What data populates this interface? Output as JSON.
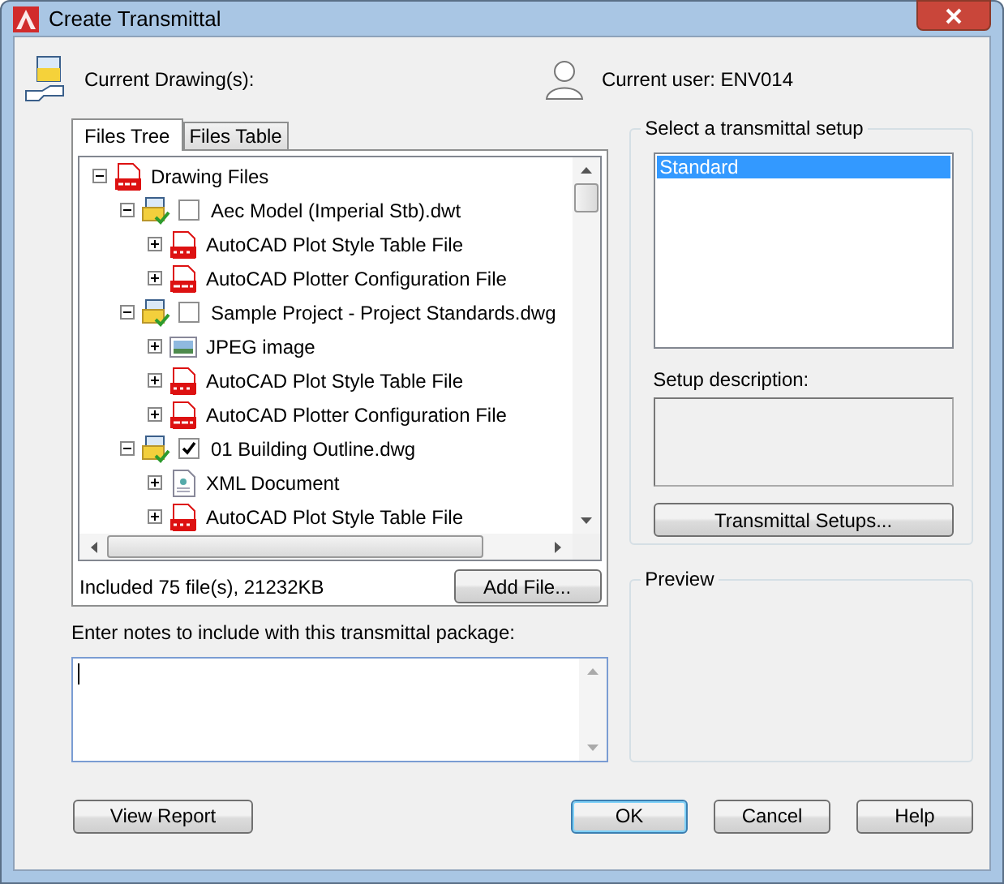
{
  "window": {
    "title": "Create Transmittal"
  },
  "current_drawings_label": "Current Drawing(s):",
  "current_user": "Current user: ENV014",
  "tabs": [
    {
      "label": "Files Tree",
      "selected": true
    },
    {
      "label": "Files Table",
      "selected": false
    }
  ],
  "tree": [
    {
      "kind": "dwt",
      "label": "Drawing Files",
      "expanded": true,
      "children": [
        {
          "kind": "drawing",
          "label": "Aec Model (Imperial Stb).dwt",
          "expanded": true,
          "checked": false,
          "children": [
            {
              "kind": "stb",
              "label": "AutoCAD Plot Style Table File",
              "expanded": false
            },
            {
              "kind": "pc3",
              "label": "AutoCAD Plotter Configuration File",
              "expanded": false
            }
          ]
        },
        {
          "kind": "drawing",
          "label": "Sample Project - Project Standards.dwg",
          "expanded": true,
          "checked": false,
          "children": [
            {
              "kind": "jpeg",
              "label": "JPEG image",
              "expanded": false
            },
            {
              "kind": "stb",
              "label": "AutoCAD Plot Style Table File",
              "expanded": false
            },
            {
              "kind": "pc3",
              "label": "AutoCAD Plotter Configuration File",
              "expanded": false
            }
          ]
        },
        {
          "kind": "drawing",
          "label": "01 Building Outline.dwg",
          "expanded": true,
          "checked": true,
          "children": [
            {
              "kind": "xml",
              "label": "XML Document",
              "expanded": false
            },
            {
              "kind": "stb",
              "label": "AutoCAD Plot Style Table File",
              "expanded": false
            }
          ]
        }
      ]
    }
  ],
  "included": "Included 75 file(s), 21232KB",
  "add_file": "Add File...",
  "notes_label": "Enter notes to include with this transmittal package:",
  "setup_group": "Select a transmittal setup",
  "setups": [
    {
      "label": "Standard",
      "selected": true
    }
  ],
  "setup_description_label": "Setup description:",
  "setups_button": "Transmittal Setups...",
  "preview_group": "Preview",
  "buttons": {
    "view_report": "View Report",
    "ok": "OK",
    "cancel": "Cancel",
    "help": "Help"
  }
}
